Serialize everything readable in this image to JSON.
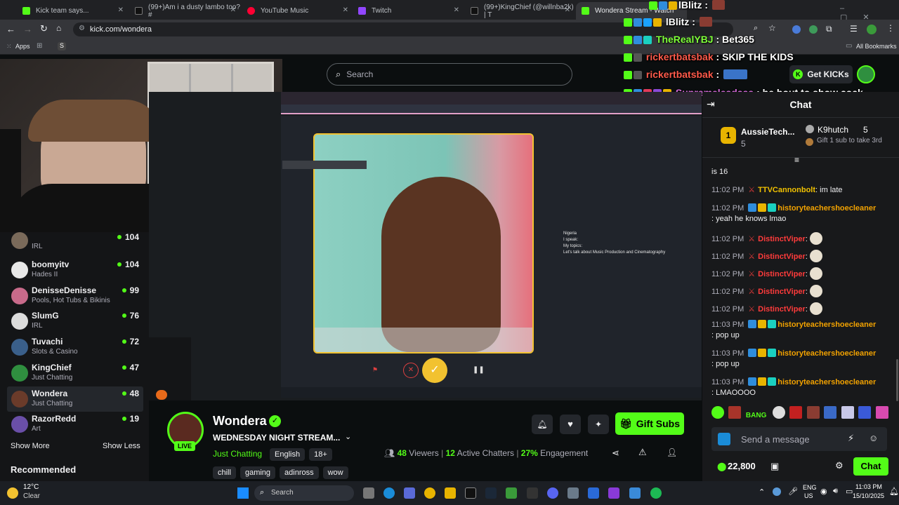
{
  "browser": {
    "tabs": [
      {
        "title": "Kick team says...",
        "color": "#53fc18"
      },
      {
        "title": "(99+)Am i a dusty lambo too? #",
        "color": "#111111"
      },
      {
        "title": "YouTube Music",
        "color": "#ff0033"
      },
      {
        "title": "Twitch",
        "color": "#9146ff"
      },
      {
        "title": "(99+)KingChief (@willnba2k) | T",
        "color": "#111111"
      },
      {
        "title": "Wondera Stream - Watch",
        "color": "#53fc18"
      }
    ],
    "url": "kick.com/wondera",
    "bookmarks": {
      "apps": "Apps",
      "all": "All Bookmarks"
    }
  },
  "overlay_chat": [
    {
      "name": "lBlitz",
      "text": ""
    },
    {
      "name": "lBlitz",
      "text": ""
    },
    {
      "name": "TheRealYBJ",
      "text": "Bet365"
    },
    {
      "name": "rickertbatsbak",
      "text": "SKIP THE KIDS"
    },
    {
      "name": "rickertbatsbak",
      "text": ""
    },
    {
      "name": "Supremeleadaaa",
      "text": "he bout to show cock"
    }
  ],
  "header": {
    "search_placeholder": "Search",
    "get_kicks": "Get KICKs"
  },
  "sidebar": {
    "channels": [
      {
        "name": "boomyitv",
        "category": "Hades II",
        "viewers": "104",
        "color": "#e8e8e8"
      },
      {
        "name": "DenisseDenisse",
        "category": "Pools, Hot Tubs & Bikinis",
        "viewers": "99",
        "color": "#c86a8a"
      },
      {
        "name": "SlumG",
        "category": "IRL",
        "viewers": "76",
        "color": "#dcdcdc"
      },
      {
        "name": "Tuvachi",
        "category": "Slots & Casino",
        "viewers": "72",
        "color": "#3a5f8a"
      },
      {
        "name": "KingChief",
        "category": "Just Chatting",
        "viewers": "47",
        "color": "#2f8f3f"
      },
      {
        "name": "Wondera",
        "category": "Just Chatting",
        "viewers": "48",
        "color": "#6a3b2a"
      },
      {
        "name": "RazorRedd",
        "category": "Art",
        "viewers": "19",
        "color": "#6a4fa8"
      }
    ],
    "partial": {
      "category": "IRL",
      "viewers": "104"
    },
    "show_more": "Show More",
    "show_less": "Show Less",
    "recommended": "Recommended"
  },
  "video": {
    "location": "Nigeria",
    "speaks": "I speak:",
    "topics": "My topics:",
    "about": "Let's talk about Music Production and Cinematography"
  },
  "stream": {
    "streamer": "Wondera",
    "live": "LIVE",
    "title": "WEDNESDAY NIGHT STREAM...",
    "category": "Just Chatting",
    "tags": [
      "English",
      "18+"
    ],
    "tags2": [
      "chill",
      "gaming",
      "adinross",
      "wow"
    ],
    "viewers": "48",
    "viewers_label": "Viewers",
    "chatters": "12",
    "chatters_label": "Active Chatters",
    "engagement": "27%",
    "engagement_label": "Engagement",
    "gift_subs": "Gift Subs"
  },
  "chat": {
    "title": "Chat",
    "leader1": {
      "rank": "1",
      "name": "AussieTech...",
      "count": "5"
    },
    "leader2": {
      "name": "K9hutch",
      "count": "5",
      "note": "Gift 1 sub to take 3rd"
    },
    "partial_msg": "is 16",
    "messages": [
      {
        "time": "11:02 PM",
        "user": "TTVCannonbolt",
        "text": "im late",
        "color": "#f2c200"
      },
      {
        "time": "11:02 PM",
        "user": "historyteachershoecleaner",
        "text": "yeah he knows lmao",
        "color": "#f2a200"
      },
      {
        "time": "11:02 PM",
        "user": "DistinctViper",
        "text": "",
        "color": "#ff3b3b"
      },
      {
        "time": "11:02 PM",
        "user": "DistinctViper",
        "text": "",
        "color": "#ff3b3b"
      },
      {
        "time": "11:02 PM",
        "user": "DistinctViper",
        "text": "",
        "color": "#ff3b3b"
      },
      {
        "time": "11:02 PM",
        "user": "DistinctViper",
        "text": "",
        "color": "#ff3b3b"
      },
      {
        "time": "11:02 PM",
        "user": "DistinctViper",
        "text": "",
        "color": "#ff3b3b"
      },
      {
        "time": "11:03 PM",
        "user": "historyteachershoecleaner",
        "text": "pop up",
        "color": "#f2a200"
      },
      {
        "time": "11:03 PM",
        "user": "historyteachershoecleaner",
        "text": "pop up",
        "color": "#f2a200"
      },
      {
        "time": "11:03 PM",
        "user": "historyteachershoecleaner",
        "text": "LMAOOOO",
        "color": "#f2a200"
      }
    ],
    "emote_bang": "BANG",
    "input_placeholder": "Send a message",
    "points": "22,800",
    "send": "Chat"
  },
  "taskbar": {
    "weather_temp": "12°C",
    "weather_desc": "Clear",
    "search": "Search",
    "lang": "ENG",
    "region": "US",
    "time": "11:03 PM",
    "date": "15/10/2025"
  }
}
